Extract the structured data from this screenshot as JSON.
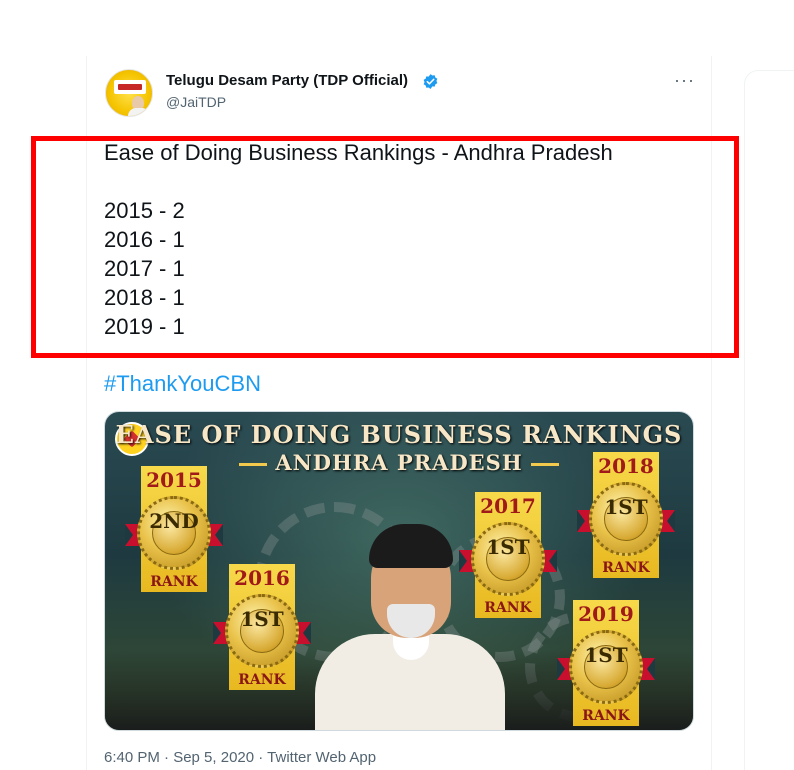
{
  "tweet": {
    "display_name": "Telugu Desam Party (TDP Official)",
    "handle": "@JaiTDP",
    "more_label": "···",
    "text_lines": [
      "Ease of Doing Business Rankings - Andhra Pradesh",
      "",
      "2015 - 2",
      "2016 - 1",
      "2017 - 1",
      "2018 - 1",
      "2019 - 1"
    ],
    "hashtag": "#ThankYouCBN",
    "timestamp": "6:40 PM · Sep 5, 2020 · Twitter Web App"
  },
  "media": {
    "title": "EASE OF DOING BUSINESS RANKINGS",
    "subtitle": "ANDHRA PRADESH",
    "badges": [
      {
        "year": "2015",
        "position": "2ND",
        "rank_label": "RANK"
      },
      {
        "year": "2016",
        "position": "1ST",
        "rank_label": "RANK"
      },
      {
        "year": "2017",
        "position": "1ST",
        "rank_label": "RANK"
      },
      {
        "year": "2018",
        "position": "1ST",
        "rank_label": "RANK"
      },
      {
        "year": "2019",
        "position": "1ST",
        "rank_label": "RANK"
      }
    ]
  },
  "colors": {
    "highlight_border": "#ff0000",
    "link": "#1d9bf0",
    "verified": "#1d9bf0",
    "secondary_text": "#536471"
  },
  "icons": {
    "verified": "verified-badge-icon",
    "more": "more-options-icon"
  }
}
